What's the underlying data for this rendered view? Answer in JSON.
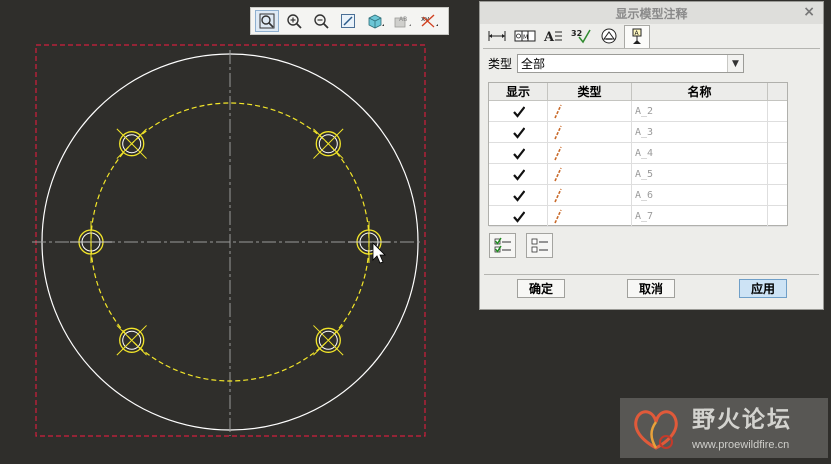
{
  "dialog": {
    "title": "显示模型注释",
    "close_glyph": "×",
    "tabs": [
      {
        "icon": "dimension-tab-icon"
      },
      {
        "icon": "gtol-tab-icon"
      },
      {
        "icon": "note-tab-icon"
      },
      {
        "icon": "surface-finish-tab-icon",
        "label": "32"
      },
      {
        "icon": "symbol-tab-icon"
      },
      {
        "icon": "datum-tab-icon",
        "active": true
      }
    ],
    "type_label": "类型",
    "type_value": "全部",
    "columns": [
      "显示",
      "类型",
      "名称"
    ],
    "rows": [
      {
        "checked": true,
        "name": "A_2"
      },
      {
        "checked": true,
        "name": "A_3"
      },
      {
        "checked": true,
        "name": "A_4"
      },
      {
        "checked": true,
        "name": "A_5"
      },
      {
        "checked": true,
        "name": "A_6"
      },
      {
        "checked": true,
        "name": "A_7"
      }
    ],
    "ok_label": "确定",
    "cancel_label": "取消",
    "apply_label": "应用"
  },
  "colors": {
    "background": "#2f2e2b",
    "geometry": "#ffffff",
    "bolt_circle": "#f2e529",
    "frame": "#d01f3c",
    "axis_line": "#9a9a9a"
  },
  "watermark": {
    "title": "野火论坛",
    "url": "www.proewildfire.cn"
  }
}
